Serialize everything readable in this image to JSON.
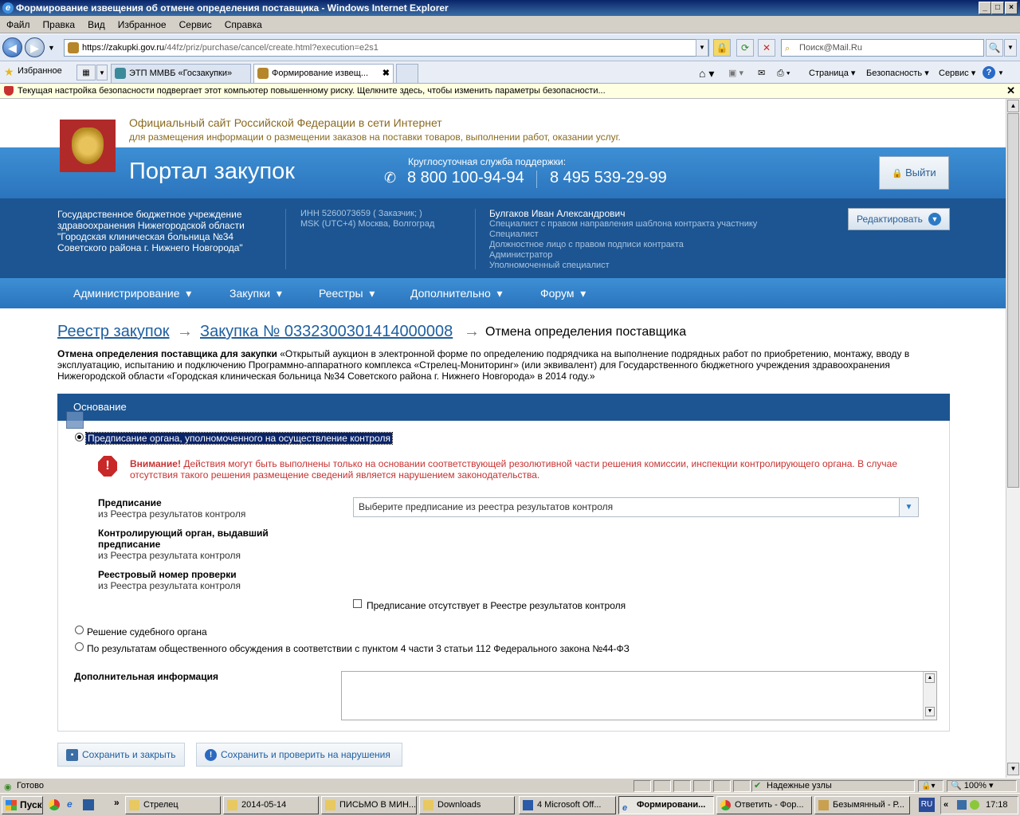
{
  "window": {
    "title": "Формирование извещения об отмене определения поставщика - Windows Internet Explorer"
  },
  "menu": [
    "Файл",
    "Правка",
    "Вид",
    "Избранное",
    "Сервис",
    "Справка"
  ],
  "address": {
    "url_host": "https://zakupki.gov.ru",
    "url_path": "/44fz/priz/purchase/cancel/create.html?execution=e2s1",
    "search_placeholder": "Поиск@Mail.Ru"
  },
  "tabs": {
    "favorites": "Избранное",
    "tab1": "ЭТП ММВБ «Госзакупки»",
    "tab2": "Формирование извещ...",
    "commands": [
      "Страница",
      "Безопасность",
      "Сервис"
    ]
  },
  "security_bar": "Текущая настройка безопасности подвергает этот компьютер повышенному риску. Щелкните здесь, чтобы изменить параметры безопасности...",
  "site": {
    "title": "Официальный сайт Российской Федерации в сети Интернет",
    "subtitle": "для размещения информации о размещении заказов на поставки товаров, выполнении работ, оказании услуг.",
    "portal": "Портал закупок",
    "support_label": "Круглосуточная служба поддержки:",
    "phone1": "8 800 100-94-94",
    "phone2": "8 495 539-29-99",
    "logout": "Выйти"
  },
  "org": {
    "name_line1": "Государственное бюджетное учреждение",
    "name_line2": "здравоохранения Нижегородской области",
    "name_line3": "\"Городская клиническая больница №34",
    "name_line4": "Советского района г. Нижнего Новгорода\"",
    "inn": "ИНН 5260073659 ( Заказчик; )",
    "tz": "MSK (UTC+4) Москва, Волгоград"
  },
  "user": {
    "name": "Булгаков Иван Александрович",
    "roles": [
      "Специалист с правом направления шаблона контракта участнику",
      "Специалист",
      "Должностное лицо с правом подписи контракта",
      "Администратор",
      "Уполномоченный специалист"
    ],
    "edit": "Редактировать"
  },
  "nav": [
    "Администрирование",
    "Закупки",
    "Реестры",
    "Дополнительно",
    "Форум"
  ],
  "breadcrumb": {
    "item1": "Реестр закупок",
    "item2": "Закупка № 0332300301414000008",
    "current": "Отмена определения поставщика"
  },
  "description": {
    "lead": "Отмена определения поставщика для закупки",
    "text": " «Открытый аукцион в электронной форме по определению подрядчика на выполнение подрядных работ по приобретению, монтажу, вводу в эксплуатацию, испытанию и подключению Программно-аппаратного комплекса «Стрелец-Мониторинг» (или эквивалент) для Государственного бюджетного учреждения здравоохранения Нижегородской области «Городская клиническая больница №34 Советского района г. Нижнего Новгорода» в 2014 году.»"
  },
  "form": {
    "section": "Основание",
    "option1": "Предписание органа, уполномоченного на осуществление контроля",
    "warning_bold": "Внимание!",
    "warning_text": " Действия могут быть выполнены только на основании соответствующей резолютивной части решения комиссии, инспекции контролирующего органа. В случае отсутствия такого решения размещение сведений является нарушением законодательства.",
    "f1_label": "Предписание",
    "f1_sub": "из Реестра результатов контроля",
    "select_placeholder": "Выберите предписание из реестра результатов контроля",
    "f2_label1": "Контролирующий орган, выдавший",
    "f2_label2": "предписание",
    "f2_sub": "из Реестра результата контроля",
    "f3_label": "Реестровый номер проверки",
    "f3_sub": "из Реестра результата контроля",
    "checkbox": "Предписание отсутствует в Реестре результатов контроля",
    "option2": "Решение судебного органа",
    "option3": "По результатам общественного обсуждения в соответствии с пунктом 4 части 3 статьи 112 Федерального закона №44-ФЗ",
    "additional": "Дополнительная информация",
    "save_close": "Сохранить и закрыть",
    "save_check": "Сохранить и проверить на нарушения"
  },
  "status": {
    "text": "Готово",
    "zone": "Надежные узлы",
    "zoom": "100%"
  },
  "taskbar": {
    "start": "Пуск",
    "items": [
      "Стрелец",
      "2014-05-14",
      "ПИСЬМО В МИН...",
      "Downloads",
      "4 Microsoft Off...",
      "Формировани...",
      "Ответить - Фор...",
      "Безымянный - Р..."
    ],
    "lang": "RU",
    "time": "17:18"
  }
}
